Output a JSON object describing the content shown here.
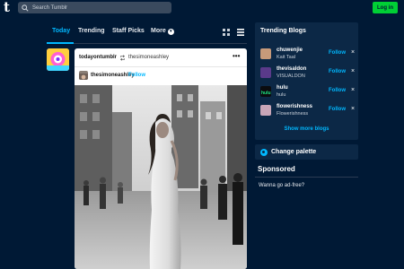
{
  "header": {
    "logo": "t",
    "search_placeholder": "Search Tumblr",
    "login_label": "Log in"
  },
  "tabs": [
    {
      "label": "Today",
      "active": true
    },
    {
      "label": "Trending",
      "active": false
    },
    {
      "label": "Staff Picks",
      "active": false
    },
    {
      "label": "More",
      "active": false
    }
  ],
  "post": {
    "blog": "todayontumblr",
    "reblogged_from": "thesimoneashley",
    "more_menu": "•••",
    "source_blog": "thesimoneashley",
    "follow_label": "Follow",
    "photo_icon": "photo-of-woman-in-white-gown-on-street"
  },
  "trending_blogs": {
    "title": "Trending Blogs",
    "items": [
      {
        "name": "chuwenjie",
        "desc": "Kait Taal",
        "follow": "Follow",
        "dismiss": "×",
        "avatar_color": "#c79a7a"
      },
      {
        "name": "thevisaldon",
        "desc": "VISUALDON",
        "follow": "Follow",
        "dismiss": "×",
        "avatar_color": "#5a3a8a"
      },
      {
        "name": "hulu",
        "desc": "hulu",
        "follow": "Follow",
        "dismiss": "×",
        "avatar_color": "#1ce783"
      },
      {
        "name": "flowerishness",
        "desc": "Flowerishness",
        "follow": "Follow",
        "dismiss": "×",
        "avatar_color": "#c9a6b8"
      }
    ],
    "show_more": "Show more blogs"
  },
  "palette": {
    "label": "Change palette"
  },
  "sponsored": {
    "title": "Sponsored",
    "text": "Wanna go ad-free?"
  },
  "colors": {
    "background": "#001935",
    "accent": "#00b8ff",
    "login_green": "#00cf35",
    "panel": "#0c2846"
  }
}
